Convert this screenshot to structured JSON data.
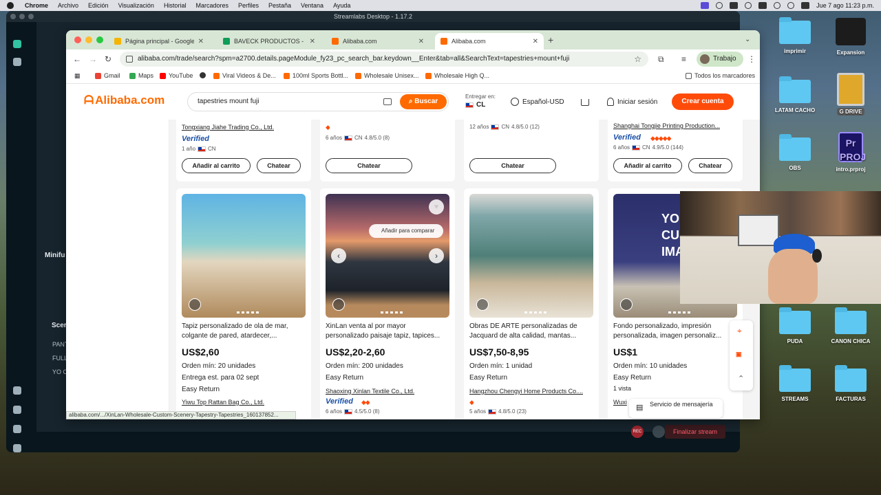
{
  "menubar": {
    "app": "Chrome",
    "items": [
      "Archivo",
      "Edición",
      "Visualización",
      "Historial",
      "Marcadores",
      "Perfiles",
      "Pestaña",
      "Ventana",
      "Ayuda"
    ],
    "clock": "Jue 7 ago 11:23 p.m."
  },
  "streamlabs": {
    "title": "Streamlabs Desktop - 1.17.2",
    "panel_label": "Minifu",
    "scenes_label": "Scer",
    "scene_items": [
      "PANT",
      "FULL",
      "YO C"
    ],
    "finish_stream": "Finalizar stream",
    "rec_label": "REC"
  },
  "browser": {
    "tabs": [
      {
        "label": "Página principal - Google Drive",
        "color": "#f4b400"
      },
      {
        "label": "BAVECK PRODUCTOS - Hoja de cálculo",
        "color": "#0f9d58"
      },
      {
        "label": "Alibaba.com",
        "color": "#ff6a00"
      },
      {
        "label": "Alibaba.com",
        "color": "#ff6a00"
      }
    ],
    "url": "alibaba.com/trade/search?spm=a2700.details.pageModule_fy23_pc_search_bar.keydown__Enter&tab=all&SearchText=tapestries+mount+fuji",
    "profile": "Trabajo",
    "bookmarks": [
      "Gmail",
      "Maps",
      "YouTube",
      "",
      "Viral Videos & De...",
      "100ml Sports Bottl...",
      "Wholesale Unisex...",
      "Wholesale High Q..."
    ],
    "all_bookmarks": "Todos los marcadores",
    "status_url": "alibaba.com/.../XinLan-Wholesale-Custom-Scenery-Tapestry-Tapestries_160137852..."
  },
  "alibaba": {
    "logo": "Alibaba.com",
    "search_query": "tapestries mount fuji",
    "search_button": "Buscar",
    "deliver_label": "Entregar en:",
    "country": "CL",
    "language": "Español-USD",
    "signin": "Iniciar sesión",
    "signup": "Crear cuenta",
    "compare_tip": "Añadir para comparar",
    "messaging": "Servicio de mensajería",
    "top_row": [
      {
        "supplier": "Tongxiang Jiahe Trading Co., Ltd.",
        "verified": "Verified",
        "meta": "1 año",
        "cc": "CN",
        "rating": "",
        "btn1": "Añadir al carrito",
        "btn2": "Chatear"
      },
      {
        "supplier": "",
        "verified": "",
        "meta": "6 años",
        "cc": "CN",
        "rating": "4.8/5.0 (8)",
        "btn1": "",
        "btn2": "Chatear"
      },
      {
        "supplier": "",
        "verified": "",
        "meta": "12 años",
        "cc": "CN",
        "rating": "4.8/5.0 (12)",
        "btn1": "",
        "btn2": "Chatear"
      },
      {
        "supplier": "Shanghai Tongjie Printing Production...",
        "verified": "Verified",
        "meta": "6 años",
        "cc": "CN",
        "rating": "4.9/5.0 (144)",
        "btn1": "Añadir al carrito",
        "btn2": "Chatear"
      }
    ],
    "products": [
      {
        "title": "Tapiz personalizado de ola de mar, colgante de pared, atardecer,...",
        "price": "US$2,60",
        "moq": "Orden mín: 20 unidades",
        "line3": "Entrega est. para 02 sept",
        "line4": "Easy Return",
        "supplier": "Yiwu Top Rattan Bag Co., Ltd.",
        "verified": "",
        "meta": "",
        "rating": ""
      },
      {
        "title": "XinLan venta al por mayor personalizado paisaje tapiz, tapices...",
        "price": "US$2,20-2,60",
        "moq": "Orden mín: 200 unidades",
        "line3": "Easy Return",
        "line4": "",
        "supplier": "Shaoxing Xinlan Textile Co., Ltd.",
        "verified": "Verified",
        "meta": "6 años",
        "rating": "4.5/5.0 (8)"
      },
      {
        "title": "Obras DE ARTE personalizadas de Jacquard de alta calidad, mantas...",
        "price": "US$7,50-8,95",
        "moq": "Orden mín: 1 unidad",
        "line3": "Easy Return",
        "line4": "",
        "supplier": "Hangzhou Chengyi Home Products Co....",
        "verified": "",
        "meta": "5 años",
        "rating": "4.8/5.0 (23)"
      },
      {
        "title": "Fondo personalizado, impresión personalizada, imagen personaliz...",
        "price": "US$1",
        "moq": "Orden mín: 10 unidades",
        "line3": "Easy Return",
        "line4": "1 vista",
        "supplier": "Wuxi",
        "verified": "",
        "meta": "",
        "rating": ""
      }
    ],
    "img4_text": "YOU CUST IMA"
  },
  "desktop": {
    "icons": [
      {
        "label": "imprimir",
        "kind": "folder"
      },
      {
        "label": "Expansion",
        "kind": "drive"
      },
      {
        "label": "LATAM CACHO",
        "kind": "folder"
      },
      {
        "label": "G DRIVE",
        "kind": "gdrive"
      },
      {
        "label": "OBS",
        "kind": "folder"
      },
      {
        "label": "intro.prproj",
        "kind": "prproj"
      },
      {
        "label": "PUDA",
        "kind": "folder"
      },
      {
        "label": "CANON CHICA",
        "kind": "folder"
      },
      {
        "label": "STREAMS",
        "kind": "folder"
      },
      {
        "label": "FACTURAS",
        "kind": "folder"
      }
    ],
    "prproj_text": "Pr PROJ"
  },
  "colors": {
    "alibaba_orange": "#ff6a00",
    "signup_red": "#ff4b0a",
    "verified_blue": "#1a4fa8",
    "chrome_tabbar": "#d8e6d5"
  }
}
